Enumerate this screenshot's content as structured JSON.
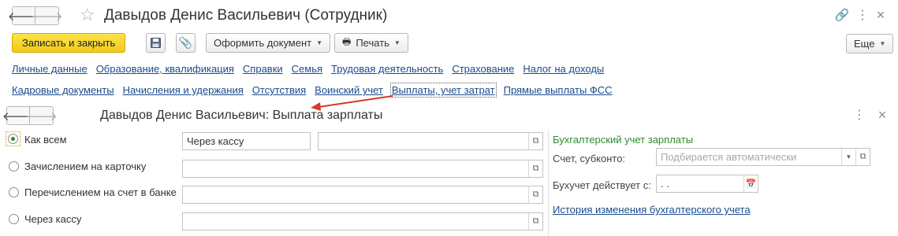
{
  "window": {
    "title": "Давыдов Денис Васильевич (Сотрудник)"
  },
  "toolbar": {
    "save_close": "Записать и закрыть",
    "create_document": "Оформить документ",
    "print": "Печать",
    "more": "Еще"
  },
  "links_row1": [
    "Личные данные",
    "Образование, квалификация",
    "Справки",
    "Семья",
    "Трудовая деятельность",
    "Страхование",
    "Налог на доходы"
  ],
  "links_row2": [
    "Кадровые документы",
    "Начисления и удержания",
    "Отсутствия",
    "Воинский учет",
    "Выплаты, учет затрат",
    "Прямые выплаты ФСС"
  ],
  "form": {
    "title": "Давыдов Денис Васильевич: Выплата зарплаты",
    "payment_options": [
      {
        "label": "Как всем",
        "selected": true,
        "field1": "Через кассу",
        "field2": ""
      },
      {
        "label": "Зачислением на карточку",
        "selected": false,
        "field1": "",
        "field2": ""
      },
      {
        "label": "Перечислением на счет в банке",
        "selected": false,
        "field1": "",
        "field2": ""
      },
      {
        "label": "Через кассу",
        "selected": false,
        "field1": "",
        "field2": ""
      }
    ],
    "accounting": {
      "section_title": "Бухгалтерский учет зарплаты",
      "account_label": "Счет, субконто:",
      "account_placeholder": "Подбирается автоматически",
      "effective_label": "Бухучет действует с:",
      "effective_date": " .  .",
      "history_link": "История изменения бухгалтерского учета"
    }
  },
  "colors": {
    "primary_button": "#f2c91c",
    "link": "#1a4b8c",
    "section_title": "#2e8b2e",
    "selected_radio": "#2a8a2a",
    "annotation_arrow": "#d9382b"
  }
}
